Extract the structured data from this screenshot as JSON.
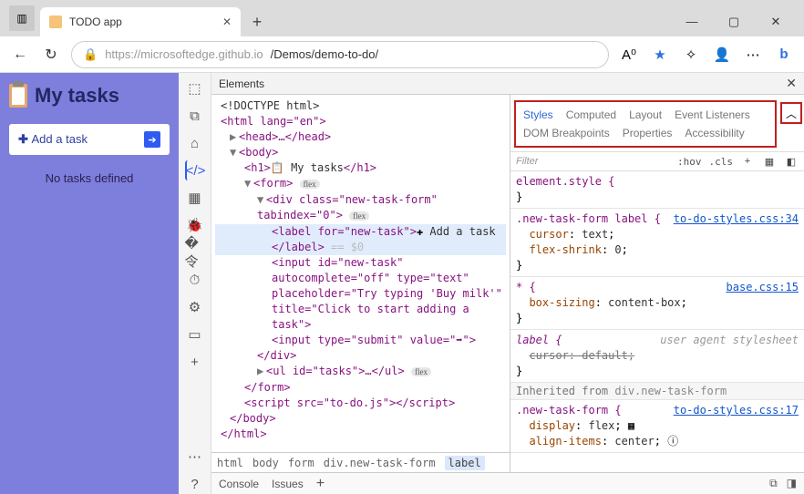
{
  "window": {
    "tab_title": "TODO app",
    "url_host": "https://microsoftedge.github.io",
    "url_path": "/Demos/demo-to-do/",
    "controls": {
      "min": "—",
      "max": "▢",
      "close": "✕"
    }
  },
  "app": {
    "title": "My tasks",
    "add_button": "Add a task",
    "no_tasks": "No tasks defined"
  },
  "activity_icons": [
    "inspect",
    "device",
    "home",
    "elements",
    "app",
    "bug",
    "wifi",
    "perf",
    "settings",
    "dock",
    "plus"
  ],
  "devtools": {
    "panel": "Elements",
    "breadcrumbs": [
      "html",
      "body",
      "form",
      "div.new-task-form",
      "label"
    ],
    "sidebar_tabs_row1": [
      "Styles",
      "Computed",
      "Layout",
      "Event Listeners"
    ],
    "sidebar_tabs_row2": [
      "DOM Breakpoints",
      "Properties",
      "Accessibility"
    ],
    "filter_placeholder": "Filter",
    "filter_chips": [
      ":hov",
      ".cls"
    ],
    "drawer_tabs": [
      "Console",
      "Issues"
    ]
  },
  "dom": {
    "doctype": "<!DOCTYPE html>",
    "html_open": "<html lang=\"en\">",
    "head": "<head>…</head>",
    "body_open": "<body>",
    "h1_open": "<h1>",
    "h1_text": " My tasks",
    "h1_close": "</h1>",
    "form_open": "<form>",
    "form_pill": "flex",
    "div_open": "<div class=\"new-task-form\" tabindex=\"0\">",
    "div_pill": "flex",
    "label_open": "<label for=\"new-task\">",
    "label_text": " Add a task",
    "label_close": "</label>",
    "label_ghost": "== $0",
    "input1": "<input id=\"new-task\" autocomplete=\"off\" type=\"text\" placeholder=\"Try typing 'Buy milk'\" title=\"Click to start adding a task\">",
    "input2": "<input type=\"submit\" value=\"➡\">",
    "div_close": "</div>",
    "ul": "<ul id=\"tasks\">…</ul>",
    "ul_pill": "flex",
    "form_close": "</form>",
    "script": "<script src=\"to-do.js\"></scr",
    "script2": "ipt>",
    "body_close": "</body>",
    "html_close": "</html>"
  },
  "styles": {
    "r0": {
      "sel": "element.style {",
      "close": "}"
    },
    "r1": {
      "sel": ".new-task-form label {",
      "link": "to-do-styles.css:34",
      "p1": "cursor",
      "v1": "text",
      "p2": "flex-shrink",
      "v2": "0",
      "close": "}"
    },
    "r2": {
      "sel": "* {",
      "link": "base.css:15",
      "p1": "box-sizing",
      "v1": "content-box",
      "close": "}"
    },
    "r3": {
      "sel": "label {",
      "uas": "user agent stylesheet",
      "p1": "cursor: default;",
      "close": "}"
    },
    "inh": "Inherited from ",
    "inh_sel": "div.new-task-form",
    "r4": {
      "sel": ".new-task-form {",
      "link": "to-do-styles.css:17",
      "p1": "display",
      "v1": "flex",
      "p2": "align-items",
      "v2": "center"
    }
  }
}
